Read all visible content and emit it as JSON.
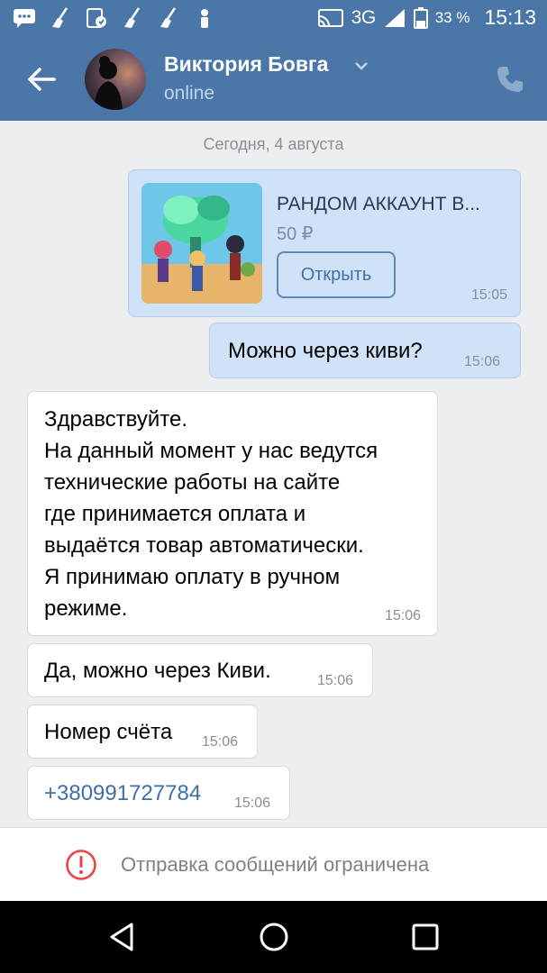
{
  "status_bar": {
    "network": "3G",
    "network_sup": "3G",
    "battery_percent": "33 %",
    "time": "15:13",
    "icons": [
      "message-icon",
      "broom-icon",
      "phone-card-icon",
      "broom-icon",
      "broom-icon",
      "user-icon",
      "cast-icon",
      "signal-icon",
      "battery-icon"
    ]
  },
  "header": {
    "contact_name": "Виктория Бовга",
    "status": "online",
    "back_icon": "back-arrow-icon",
    "call_icon": "phone-icon"
  },
  "chat": {
    "date_separator": "Сегодня, 4 августа",
    "product_card": {
      "title": "РАНДОМ АККАУНТ В...",
      "price": "50 ₽",
      "button_label": "Открыть",
      "time": "15:05"
    },
    "messages": [
      {
        "direction": "out",
        "text": "Можно через киви?",
        "time": "15:06"
      },
      {
        "direction": "in",
        "lines": [
          "Здравствуйте.",
          "На данный момент у нас ведутся",
          "технические работы на сайте",
          "где принимается оплата и",
          "выдаётся товар автоматически.",
          "Я принимаю оплату в ручном",
          "режиме."
        ],
        "time": "15:06"
      },
      {
        "direction": "in",
        "text": "Да, можно через Киви.",
        "time": "15:06"
      },
      {
        "direction": "in",
        "text": "Номер счёта",
        "time": "15:06"
      },
      {
        "direction": "in",
        "text": "+380991727784",
        "time": "15:06",
        "is_link": true
      }
    ]
  },
  "footer": {
    "restriction_text": "Отправка сообщений ограничена",
    "icon": "warning-circle-icon"
  },
  "colors": {
    "header": "#4a76a8",
    "outgoing_bubble": "#cfe2f7",
    "incoming_bubble": "#ffffff",
    "link": "#3f6fa5",
    "warning": "#e64646"
  }
}
